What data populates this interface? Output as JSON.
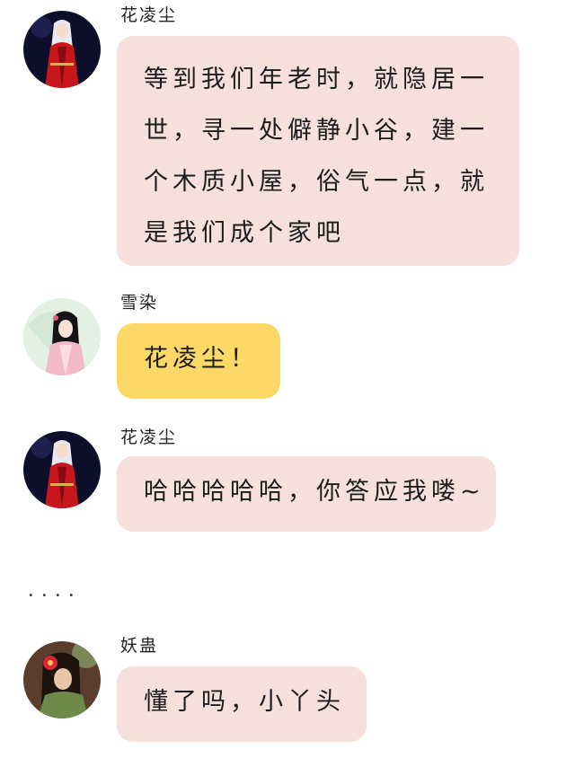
{
  "messages": [
    {
      "sender": "花凌尘",
      "avatar_icon": "white-haired-red-robed-man-avatar",
      "bubble_color": "#f6e0dc",
      "lines": [
        "等到我们年老时，就隐居一",
        "世，寻一处僻静小谷，建一",
        "个木质小屋，俗气一点，就",
        "是我们成个家吧"
      ]
    },
    {
      "sender": "雪染",
      "avatar_icon": "maiden-with-parasol-avatar",
      "bubble_color": "#fcd966",
      "lines": [
        "花凌尘！"
      ]
    },
    {
      "sender": "花凌尘",
      "avatar_icon": "white-haired-red-robed-man-avatar",
      "bubble_color": "#f6e0dc",
      "lines": [
        "哈哈哈哈哈，你答应我喽~"
      ]
    },
    {
      "sender": "妖蛊",
      "avatar_icon": "woman-with-red-flower-hairpiece-avatar",
      "bubble_color": "#f6e0dc",
      "lines": [
        "懂了吗，小丫头"
      ]
    }
  ],
  "ellipsis": "．．．．"
}
